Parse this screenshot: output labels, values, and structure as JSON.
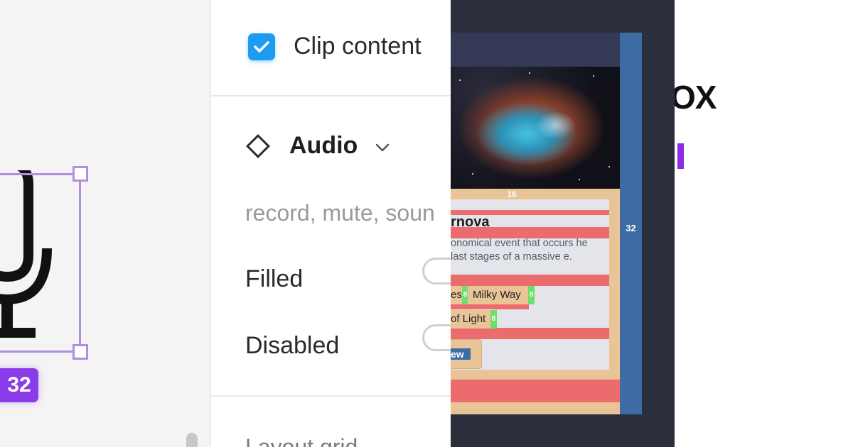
{
  "canvas": {
    "size_badge": "32",
    "icons": {
      "microphone": "microphone-icon"
    },
    "colors": {
      "selection": "#b08ee0",
      "badge": "#8a3ce8"
    }
  },
  "panel": {
    "clip_content": {
      "label": "Clip content",
      "checked": true
    },
    "audio": {
      "title": "Audio",
      "tags": "record, mute, soun"
    },
    "properties": [
      {
        "label": "Filled",
        "value": false
      },
      {
        "label": "Disabled",
        "value": false
      }
    ],
    "layout_grid_label": "Layout grid",
    "colors": {
      "checkbox": "#1c9bf0"
    }
  },
  "preview": {
    "card": {
      "title": "rnova",
      "description": "onomical event that occurs he last stages of a massive e.",
      "tags": [
        "es",
        "Milky Way",
        "of Light"
      ],
      "button": "ew"
    },
    "spacing": {
      "top": "16",
      "side": "32",
      "gap": "8"
    },
    "colors": {
      "padding": "#e8c496",
      "gap": "#ec6b6c",
      "tag_gap": "#6de06b",
      "side": "#3e6ba3"
    }
  },
  "right": {
    "wordmark_fragment": "OX",
    "colors": {
      "accent": "#8a2be2"
    }
  }
}
